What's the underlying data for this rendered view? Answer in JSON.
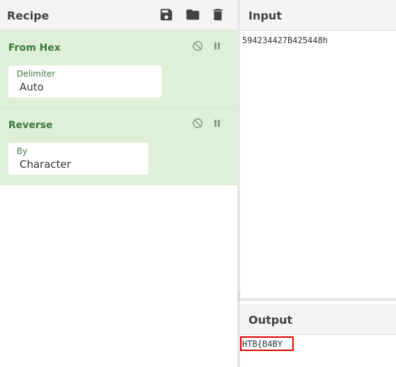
{
  "recipe": {
    "title": "Recipe",
    "buttons": [
      {
        "name": "save-recipe-button",
        "icon": "save-icon"
      },
      {
        "name": "load-recipe-button",
        "icon": "folder-icon"
      },
      {
        "name": "clear-recipe-button",
        "icon": "trash-icon"
      }
    ],
    "operations": [
      {
        "title": "From Hex",
        "arg_label": "Delimiter",
        "arg_value": "Auto",
        "controls": [
          "disable-icon",
          "pause-icon"
        ]
      },
      {
        "title": "Reverse",
        "arg_label": "By",
        "arg_value": "Character",
        "controls": [
          "disable-icon",
          "pause-icon"
        ]
      }
    ]
  },
  "input": {
    "title": "Input",
    "text": "594234427B425448h"
  },
  "output": {
    "title": "Output",
    "text": "HTB{B4BY"
  },
  "colors": {
    "op_background": "#dff0d8",
    "op_title": "#3c763d",
    "highlight": "#e00000",
    "header_bg": "#f4f4f4"
  }
}
